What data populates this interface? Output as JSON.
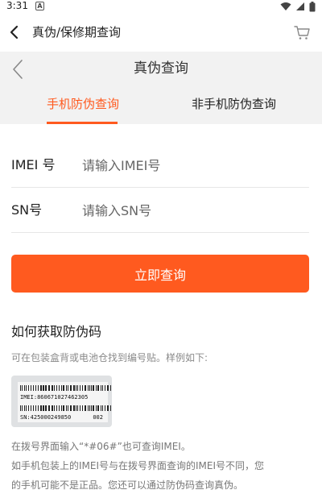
{
  "status_bar": {
    "time": "3:31",
    "notification_glyph": "A",
    "icons": [
      "wifi-icon",
      "signal-icon",
      "battery-icon"
    ]
  },
  "app_bar": {
    "title": "真伪/保修期查询",
    "icons": [
      "back-arrow-icon",
      "cart-icon"
    ]
  },
  "page_header": {
    "title": "真伪查询"
  },
  "tabs": [
    {
      "label": "手机防伪查询",
      "active": true
    },
    {
      "label": "非手机防伪查询",
      "active": false
    }
  ],
  "form": {
    "imei": {
      "label": "IMEI 号",
      "placeholder": "请输入IMEI号",
      "value": ""
    },
    "sn": {
      "label": "SN号",
      "placeholder": "请输入SN号",
      "value": ""
    }
  },
  "query_button": {
    "label": "立即查询"
  },
  "howto": {
    "title": "如何获取防伪码",
    "description": "可在包装盒背或电池仓找到编号贴。样例如下:"
  },
  "sample_label": {
    "imei_line": "IMEI:860671027462305",
    "sn_line": "SN:425000249850",
    "suffix": "002"
  },
  "notes": [
    "在拨号界面输入“*#06#”也可查询IMEI。",
    "如手机包装上的IMEI号与在拨号界面查询的IMEI号不同，您",
    "的手机可能不是正品。您还可以通过防伪码查询真伪。"
  ],
  "colors": {
    "accent": "#ff5a1f",
    "header_bg": "#f2f2f2",
    "divider": "#e6e6e6",
    "muted_text": "#8a8a8a"
  }
}
